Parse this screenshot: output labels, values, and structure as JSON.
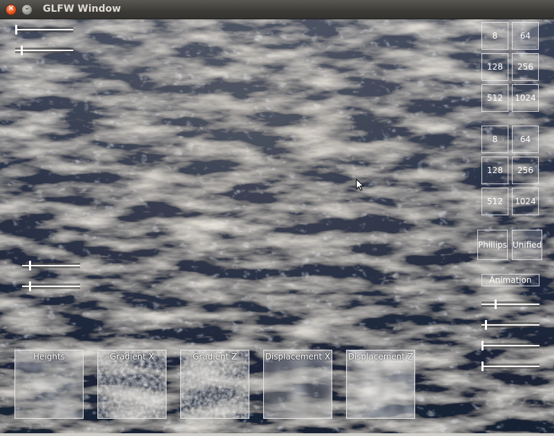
{
  "window": {
    "title": "GLFW Window"
  },
  "resolution_group_1": {
    "options": [
      "8",
      "64",
      "128",
      "256",
      "512",
      "1024"
    ],
    "selected": "64"
  },
  "resolution_group_2": {
    "options": [
      "8",
      "64",
      "128",
      "256",
      "512",
      "1024"
    ],
    "selected": "64"
  },
  "spectrum": {
    "options": [
      "Phillips",
      "Unified"
    ],
    "selected": "Unified"
  },
  "animation": {
    "label": "Animation"
  },
  "sliders": {
    "top_left": [
      0.0,
      0.1
    ],
    "left_middle": [
      0.12,
      0.12
    ],
    "right": [
      0.24,
      0.06,
      0.0,
      0.0
    ]
  },
  "thumbnails": [
    "Heights",
    "Gradient X",
    "Gradient Z",
    "Displacement X",
    "Displacement Z"
  ],
  "colors": {
    "ocean": "#1a2438",
    "highlight": "#e8e2d4",
    "ui_border": "#ebebf0"
  }
}
